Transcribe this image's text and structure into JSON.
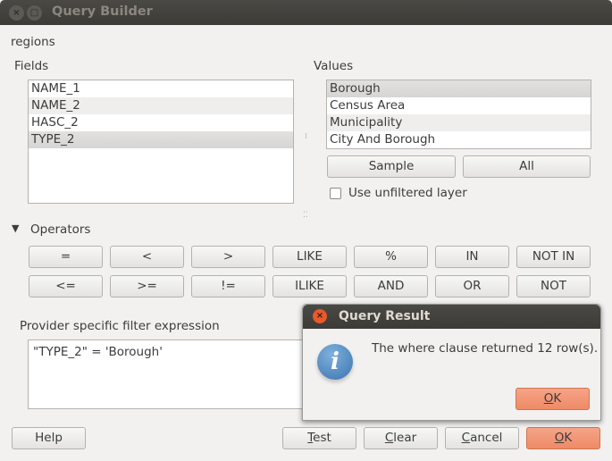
{
  "window": {
    "title": "Query Builder"
  },
  "layer_name": "regions",
  "fields": {
    "label": "Fields",
    "items": [
      "NAME_1",
      "NAME_2",
      "HASC_2",
      "TYPE_2"
    ],
    "selected": "TYPE_2"
  },
  "values": {
    "label": "Values",
    "items": [
      "Borough",
      "Census Area",
      "Municipality",
      "City And Borough"
    ],
    "selected": "Borough",
    "sample_label": "Sample",
    "all_label": "All",
    "unfiltered_label": "Use unfiltered layer",
    "unfiltered_checked": false
  },
  "operators": {
    "label": "Operators",
    "row1": [
      "=",
      "<",
      ">",
      "LIKE",
      "%",
      "IN",
      "NOT IN"
    ],
    "row2": [
      "<=",
      ">=",
      "!=",
      "ILIKE",
      "AND",
      "OR",
      "NOT"
    ]
  },
  "expression": {
    "label": "Provider specific filter expression",
    "value": "\"TYPE_2\" = 'Borough'"
  },
  "buttons": {
    "help": "Help",
    "test": "Test",
    "clear": "Clear",
    "cancel": "Cancel",
    "ok": "OK"
  },
  "dialog": {
    "title": "Query Result",
    "message": "The where clause returned 12 row(s).",
    "ok": "OK",
    "icon": "info-icon"
  }
}
